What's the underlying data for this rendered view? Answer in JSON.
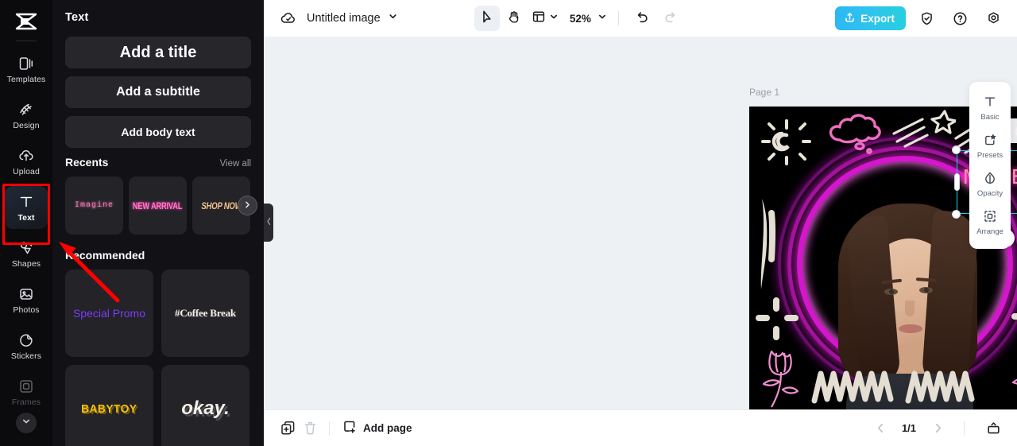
{
  "app": {
    "logo_name": "capcut-logo"
  },
  "rail": {
    "items": [
      {
        "label": "Templates",
        "icon": "templates-icon",
        "state": "normal"
      },
      {
        "label": "Design",
        "icon": "design-icon",
        "state": "normal"
      },
      {
        "label": "Upload",
        "icon": "upload-icon",
        "state": "normal"
      },
      {
        "label": "Text",
        "icon": "text-icon",
        "state": "active"
      },
      {
        "label": "Shapes",
        "icon": "shapes-icon",
        "state": "normal"
      },
      {
        "label": "Photos",
        "icon": "photos-icon",
        "state": "normal"
      },
      {
        "label": "Stickers",
        "icon": "stickers-icon",
        "state": "normal"
      },
      {
        "label": "Frames",
        "icon": "frames-icon",
        "state": "dim"
      }
    ],
    "more_icon": "chevron-down-icon",
    "highlight_color": "#fe0000"
  },
  "panel": {
    "title": "Text",
    "add_title": "Add a title",
    "add_subtitle": "Add a subtitle",
    "add_body": "Add body text",
    "recents_title": "Recents",
    "view_all": "View all",
    "recents": [
      {
        "label": "Imagine"
      },
      {
        "label": "NEW ARRIVAL"
      },
      {
        "label": "SHOP NOW"
      }
    ],
    "next_icon": "chevron-right-icon",
    "recommended_title": "Recommended",
    "recommended": [
      {
        "label": "Special Promo"
      },
      {
        "label": "#Coffee Break"
      },
      {
        "label": "BABYTOY"
      },
      {
        "label": "okay."
      }
    ],
    "collapse_icon": "chevron-left-icon"
  },
  "topbar": {
    "cloud_icon": "cloud-saved-icon",
    "doc_title": "Untitled image",
    "title_caret_icon": "chevron-down-icon",
    "tools": [
      {
        "name": "select-tool",
        "icon": "cursor-arrow-icon",
        "active": true
      },
      {
        "name": "hand-tool",
        "icon": "hand-icon",
        "active": false
      },
      {
        "name": "layout-tool",
        "icon": "layout-panel-icon",
        "active": false
      }
    ],
    "zoom_value": "52%",
    "zoom_caret_icon": "chevron-down-icon",
    "undo_icon": "undo-icon",
    "redo_icon": "redo-icon",
    "export_label": "Export",
    "export_icon": "export-upload-icon",
    "export_color": "#2ec1e8",
    "right_icons": [
      {
        "name": "shield-check-icon"
      },
      {
        "name": "help-circle-icon"
      },
      {
        "name": "settings-gear-icon"
      }
    ]
  },
  "canvas": {
    "page_label": "Page 1",
    "page_actions": [
      {
        "name": "duplicate-page-icon"
      },
      {
        "name": "more-options-icon"
      }
    ],
    "artboard": {
      "background": "#000000",
      "neon_ring_color": "#e018d8",
      "selected_text": "DIY\nMAKE\nUP",
      "selected_text_color": "#ff8ec2",
      "doodles": [
        "sun-doodle",
        "cloud-doodle",
        "shooting-star-doodle",
        "shooting-star-2-doodle",
        "cloud-2-doodle",
        "brush-stroke-left",
        "brush-stroke-right",
        "sparkle-left",
        "sparkle-right",
        "tulip-left",
        "tulip-right",
        "zigzag-scribble"
      ]
    },
    "selection": {
      "color": "#13d3e8",
      "rotate_icon": "rotate-handle-icon",
      "floating_toolbar": [
        {
          "name": "duplicate-icon"
        },
        {
          "name": "more-options-icon"
        }
      ]
    }
  },
  "inspector": {
    "items": [
      {
        "label": "Basic",
        "icon": "text-basic-icon"
      },
      {
        "label": "Presets",
        "icon": "presets-star-icon"
      },
      {
        "label": "Opacity",
        "icon": "opacity-drop-icon"
      },
      {
        "label": "Arrange",
        "icon": "arrange-icon"
      }
    ]
  },
  "bottombar": {
    "duplicate_icon": "duplicate-page-icon",
    "delete_icon": "trash-icon",
    "add_page_label": "Add page",
    "add_page_icon": "add-page-icon",
    "prev_icon": "chevron-left-icon",
    "page_indicator": "1/1",
    "next_icon": "chevron-right-icon",
    "present_icon": "present-icon"
  },
  "annotation": {
    "arrow_color": "#fe0000"
  }
}
